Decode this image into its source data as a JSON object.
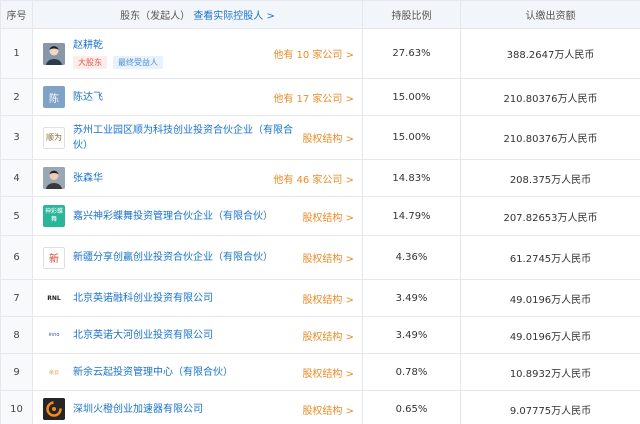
{
  "header": {
    "col_index": "序号",
    "col_holder": "股东（发起人）",
    "col_holder_link": "查看实际控股人 >",
    "col_ratio": "持股比例",
    "col_capital": "认缴出资额"
  },
  "rows": [
    {
      "index": "1",
      "avatar": "person-photo",
      "name": "赵耕乾",
      "tags": [
        "大股东",
        "最终受益人"
      ],
      "right_prefix": "他有 ",
      "right_num": "10",
      "right_suffix": " 家公司 >",
      "ratio": "27.63%",
      "capital": "388.2647万人民币"
    },
    {
      "index": "2",
      "avatar": "陈",
      "name": "陈达飞",
      "right_prefix": "他有 ",
      "right_num": "17",
      "right_suffix": " 家公司 >",
      "ratio": "15.00%",
      "capital": "210.80376万人民币"
    },
    {
      "index": "3",
      "avatar": "顺为",
      "name": "苏州工业园区顺为科技创业投资合伙企业（有限合伙）",
      "right_label": "股权结构 >",
      "ratio": "15.00%",
      "capital": "210.80376万人民币"
    },
    {
      "index": "4",
      "avatar": "person-photo",
      "name": "张森华",
      "right_prefix": "他有 ",
      "right_num": "46",
      "right_suffix": " 家公司 >",
      "ratio": "14.83%",
      "capital": "208.375万人民币"
    },
    {
      "index": "5",
      "avatar": "神彩蝶舞",
      "name": "嘉兴神彩蝶舞投资管理合伙企业（有限合伙）",
      "right_label": "股权结构 >",
      "ratio": "14.79%",
      "capital": "207.82653万人民币"
    },
    {
      "index": "6",
      "avatar": "新",
      "name": "新疆分享创赢创业投资合伙企业（有限合伙）",
      "right_label": "股权结构 >",
      "ratio": "4.36%",
      "capital": "61.2745万人民币"
    },
    {
      "index": "7",
      "avatar": "RNL",
      "name": "北京英诺融科创业投资有限公司",
      "right_label": "股权结构 >",
      "ratio": "3.49%",
      "capital": "49.0196万人民币"
    },
    {
      "index": "8",
      "avatar": "inno",
      "name": "北京英诺大河创业投资有限公司",
      "right_label": "股权结构 >",
      "ratio": "3.49%",
      "capital": "49.0196万人民币"
    },
    {
      "index": "9",
      "avatar": "余云",
      "name": "新余云起投资管理中心（有限合伙）",
      "right_label": "股权结构 >",
      "ratio": "0.78%",
      "capital": "10.8932万人民币"
    },
    {
      "index": "10",
      "avatar": "huo-logo",
      "name": "深圳火橙创业加速器有限公司",
      "right_label": "股权结构 >",
      "ratio": "0.65%",
      "capital": "9.07775万人民币"
    }
  ],
  "colors": {
    "link": "#1a73c9",
    "orange": "#e98b27",
    "header_bg": "#f2f5f9",
    "border": "#e4e8ee"
  }
}
